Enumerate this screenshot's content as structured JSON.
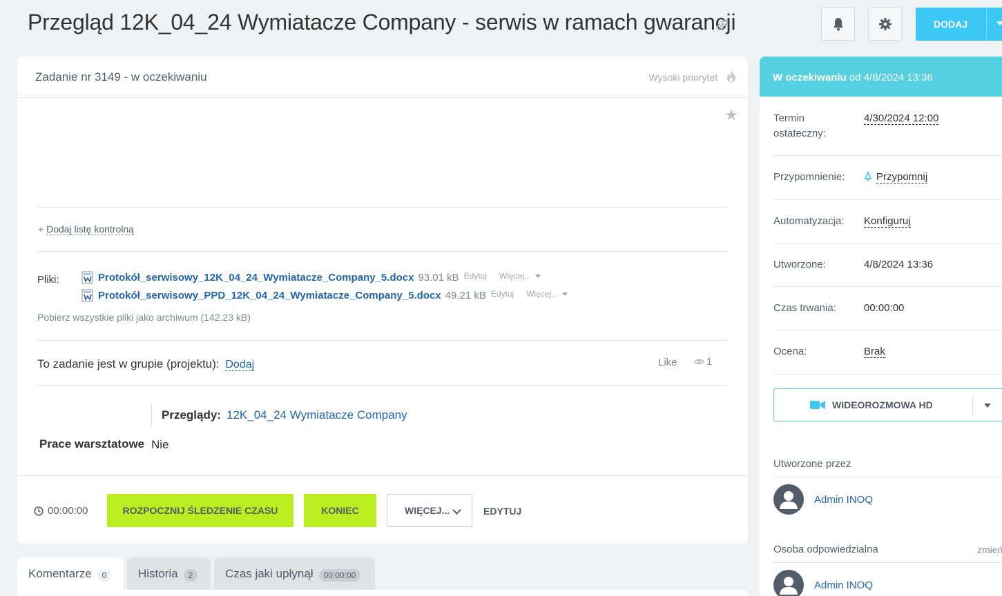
{
  "header": {
    "title": "Przegląd 12K_04_24 Wymiatacze Company - serwis w ramach gwarancji",
    "add_label": "DODAJ"
  },
  "task": {
    "title": "Zadanie nr 3149 - w oczekiwaniu",
    "priority": "Wysoki priorytet",
    "checklist_plus": "+",
    "checklist_label": "Dodaj listę kontrolną",
    "files_label": "Pliki:",
    "files": [
      {
        "name": "Protokół_serwisowy_12K_04_24_Wymiatacze_Company_5.docx",
        "size": "93.01 kB",
        "edit": "Edytuj",
        "more": "Więcej..."
      },
      {
        "name": "Protokół_serwisowy_PPD_12K_04_24_Wymiatacze_Company_5.docx",
        "size": "49.21 kB",
        "edit": "Edytuj",
        "more": "Więcej..."
      }
    ],
    "archive": "Pobierz wszystkie pliki jako archiwum (142.23 kB)",
    "group_text": "To zadanie jest w grupie (projektu):",
    "group_add": "Dodaj",
    "like": "Like",
    "views": "1",
    "przeglady_label": "Przeglądy:",
    "przeglady_value": "12K_04_24 Wymiatacze Company",
    "work_label": "Prace warsztatowe",
    "work_value": "Nie"
  },
  "footer": {
    "timer": "00:00:00",
    "start_label": "ROZPOCZNIJ ŚLEDZENIE CZASU",
    "end_label": "KONIEC",
    "more_label": "WIĘCEJ...",
    "edit_label": "EDYTUJ"
  },
  "tabs": [
    {
      "label": "Komentarze",
      "count": "0"
    },
    {
      "label": "Historia",
      "count": "2"
    },
    {
      "label": "Czas jaki upłynął",
      "count": "00:00:00"
    }
  ],
  "sidebar": {
    "status_bold": "W oczekiwaniu",
    "status_rest": "od 4/8/2024 13:36",
    "deadline_label_1": "Termin",
    "deadline_label_2": "ostateczny:",
    "deadline_value": "4/30/2024 12:00",
    "reminder_label": "Przypomnienie:",
    "reminder_value": "Przypomnij",
    "automation_label": "Automatyzacja:",
    "automation_value": "Konfiguruj",
    "created_label": "Utworzone:",
    "created_value": "4/8/2024 13:36",
    "duration_label": "Czas trwania:",
    "duration_value": "00:00:00",
    "rating_label": "Ocena:",
    "rating_value": "Brak",
    "video_label": "WIDEOROZMOWA HD",
    "created_by_label": "Utworzone przez",
    "created_by_name": "Admin INOQ",
    "responsible_label": "Osoba odpowiedzialna",
    "responsible_change": "zmień",
    "responsible_name": "Admin INOQ"
  },
  "colors": {
    "accent_blue": "#3bc8f5",
    "status_teal": "#55d0e0",
    "action_green": "#bbed21",
    "link_blue": "#2067b0"
  }
}
